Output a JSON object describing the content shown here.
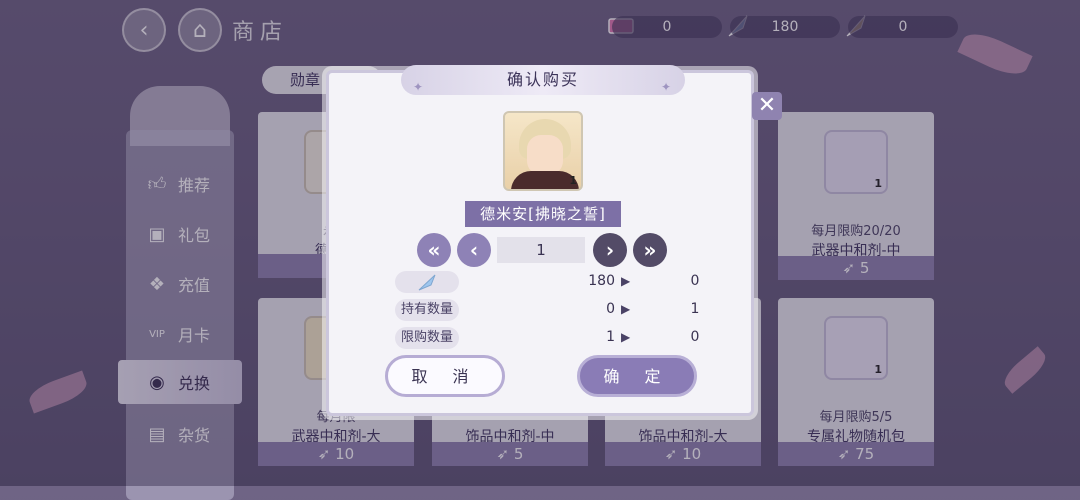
{
  "topbar": {
    "title": "商店",
    "resources": [
      {
        "icon": "ticket-icon",
        "value": "0"
      },
      {
        "icon": "feather-icon",
        "value": "180"
      },
      {
        "icon": "gold-feather-icon",
        "value": "0"
      }
    ]
  },
  "tab": {
    "label": "勋章"
  },
  "sidebar": {
    "items": [
      {
        "label": "推荐",
        "icon": "thumbs-up-icon"
      },
      {
        "label": "礼包",
        "icon": "gift-icon"
      },
      {
        "label": "充值",
        "icon": "recharge-icon"
      },
      {
        "label": "月卡",
        "icon": "vip-card-icon"
      },
      {
        "label": "兑换",
        "icon": "exchange-icon"
      },
      {
        "label": "杂货",
        "icon": "briefcase-icon"
      }
    ]
  },
  "cards": [
    {
      "sub": "永久",
      "name": "德米安",
      "price": ""
    },
    {
      "sub": "每月限购20/20",
      "name": "武器中和剂-中",
      "price": "5",
      "count": "1"
    },
    {
      "sub": "每月限",
      "name": "武器中和剂-大",
      "price": "10"
    },
    {
      "sub": "",
      "name": "饰品中和剂-中",
      "price": "5"
    },
    {
      "sub": "",
      "name": "饰品中和剂-大",
      "price": "10"
    },
    {
      "sub": "每月限购5/5",
      "name": "专属礼物随机包",
      "price": "75",
      "count": "1"
    }
  ],
  "modal": {
    "title": "确认购买",
    "item_name": "德米安[拂晓之誓]",
    "item_count": "1",
    "quantity": "1",
    "rows": [
      {
        "label": "",
        "icon": "feather-icon",
        "from": "180",
        "to": "0"
      },
      {
        "label": "持有数量",
        "from": "0",
        "to": "1"
      },
      {
        "label": "限购数量",
        "from": "1",
        "to": "0"
      }
    ],
    "cancel": "取 消",
    "confirm": "确 定",
    "close": "✕"
  }
}
